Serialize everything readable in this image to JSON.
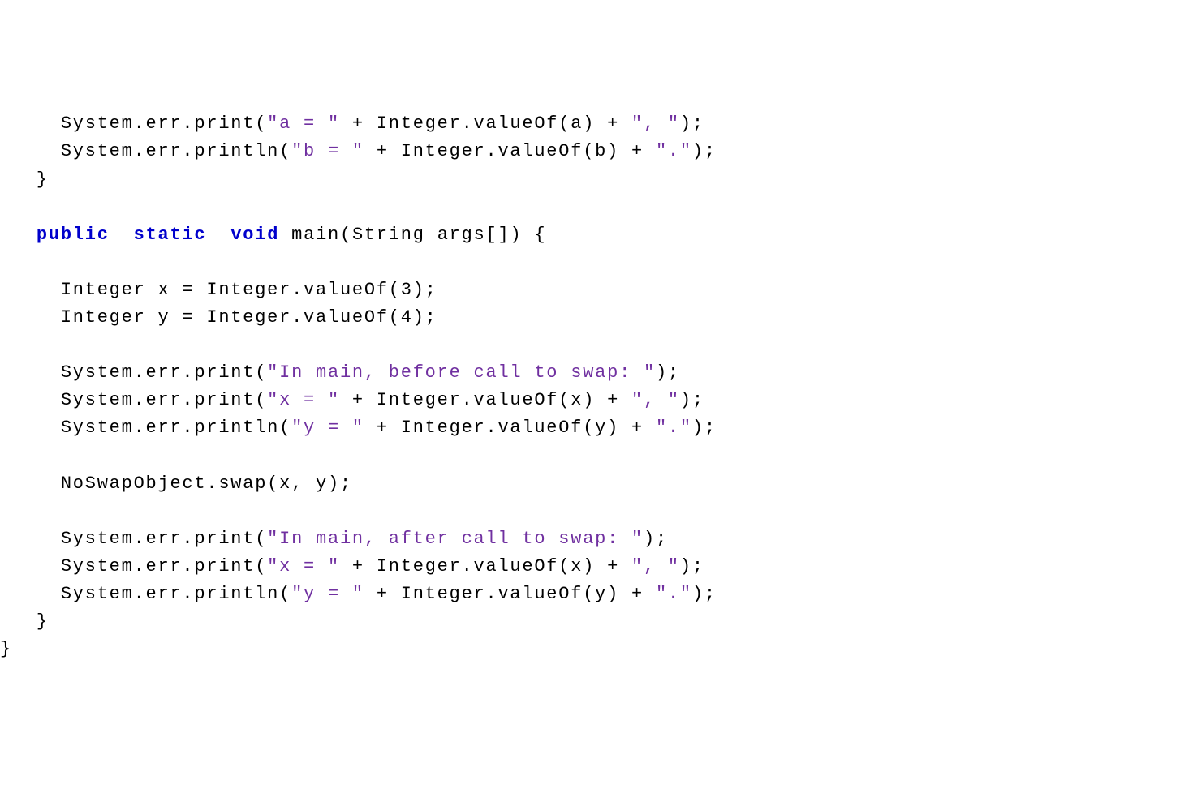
{
  "code": {
    "i1": "     ",
    "i2": "        ",
    "i3": "   ",
    "l1a": "System.err.print(",
    "l1s": "\"a = \"",
    "l1b": " + Integer.valueOf(a) + ",
    "l1s2": "\", \"",
    "l1c": ");",
    "l2a": "System.err.println(",
    "l2s": "\"b = \"",
    "l2b": " + Integer.valueOf(b) + ",
    "l2s2": "\".\"",
    "l2c": ");",
    "l3": "}",
    "kw_public": "public",
    "kw_static": "static",
    "kw_void": "void",
    "l5a": " main(String args[]) {",
    "l6": "Integer x = Integer.valueOf(3);",
    "l7": "Integer y = Integer.valueOf(4);",
    "l8a": "System.err.print(",
    "l8s": "\"In main, before call to swap: \"",
    "l8b": ");",
    "l9a": "System.err.print(",
    "l9s": "\"x = \"",
    "l9b": " + Integer.valueOf(x) + ",
    "l9s2": "\", \"",
    "l9c": ");",
    "l10a": "System.err.println(",
    "l10s": "\"y = \"",
    "l10b": " + Integer.valueOf(y) + ",
    "l10s2": "\".\"",
    "l10c": ");",
    "l11": "NoSwapObject.swap(x, y);",
    "l12a": "System.err.print(",
    "l12s": "\"In main, after call to swap: \"",
    "l12b": ");",
    "l13a": "System.err.print(",
    "l13s": "\"x = \"",
    "l13b": " + Integer.valueOf(x) + ",
    "l13s2": "\", \"",
    "l13c": ");",
    "l14a": "System.err.println(",
    "l14s": "\"y = \"",
    "l14b": " + Integer.valueOf(y) + ",
    "l14s2": "\".\"",
    "l14c": ");",
    "l15": "}",
    "l16": "}",
    "sp": " ",
    "sp2": "  "
  }
}
